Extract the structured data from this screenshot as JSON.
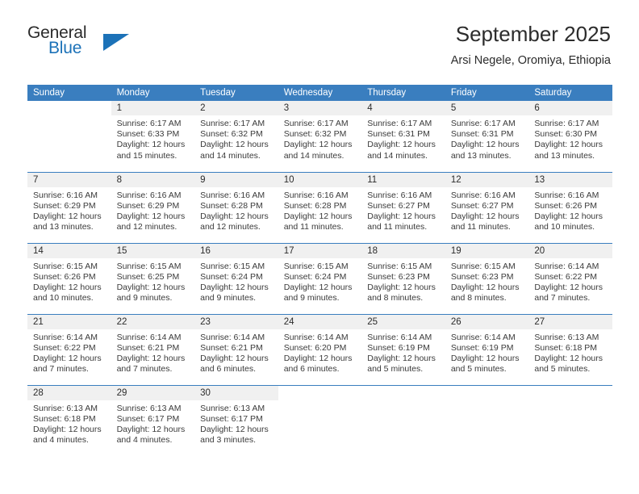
{
  "brand": {
    "name_part1": "General",
    "name_part2": "Blue",
    "logo_icon": "blue-triangle-flag",
    "color_dark": "#2b2b2b",
    "color_blue": "#1c72b8"
  },
  "header": {
    "title": "September 2025",
    "subtitle": "Arsi Negele, Oromiya, Ethiopia"
  },
  "calendar": {
    "header_bg": "#3a7ebf",
    "daynum_bg": "#f0f0f0",
    "weekday_headers": [
      "Sunday",
      "Monday",
      "Tuesday",
      "Wednesday",
      "Thursday",
      "Friday",
      "Saturday"
    ],
    "weeks": [
      [
        {
          "day": "",
          "sunrise": "",
          "sunset": "",
          "daylight_line1": "",
          "daylight_line2": "",
          "blank": true
        },
        {
          "day": "1",
          "sunrise": "Sunrise: 6:17 AM",
          "sunset": "Sunset: 6:33 PM",
          "daylight_line1": "Daylight: 12 hours",
          "daylight_line2": "and 15 minutes."
        },
        {
          "day": "2",
          "sunrise": "Sunrise: 6:17 AM",
          "sunset": "Sunset: 6:32 PM",
          "daylight_line1": "Daylight: 12 hours",
          "daylight_line2": "and 14 minutes."
        },
        {
          "day": "3",
          "sunrise": "Sunrise: 6:17 AM",
          "sunset": "Sunset: 6:32 PM",
          "daylight_line1": "Daylight: 12 hours",
          "daylight_line2": "and 14 minutes."
        },
        {
          "day": "4",
          "sunrise": "Sunrise: 6:17 AM",
          "sunset": "Sunset: 6:31 PM",
          "daylight_line1": "Daylight: 12 hours",
          "daylight_line2": "and 14 minutes."
        },
        {
          "day": "5",
          "sunrise": "Sunrise: 6:17 AM",
          "sunset": "Sunset: 6:31 PM",
          "daylight_line1": "Daylight: 12 hours",
          "daylight_line2": "and 13 minutes."
        },
        {
          "day": "6",
          "sunrise": "Sunrise: 6:17 AM",
          "sunset": "Sunset: 6:30 PM",
          "daylight_line1": "Daylight: 12 hours",
          "daylight_line2": "and 13 minutes."
        }
      ],
      [
        {
          "day": "7",
          "sunrise": "Sunrise: 6:16 AM",
          "sunset": "Sunset: 6:29 PM",
          "daylight_line1": "Daylight: 12 hours",
          "daylight_line2": "and 13 minutes."
        },
        {
          "day": "8",
          "sunrise": "Sunrise: 6:16 AM",
          "sunset": "Sunset: 6:29 PM",
          "daylight_line1": "Daylight: 12 hours",
          "daylight_line2": "and 12 minutes."
        },
        {
          "day": "9",
          "sunrise": "Sunrise: 6:16 AM",
          "sunset": "Sunset: 6:28 PM",
          "daylight_line1": "Daylight: 12 hours",
          "daylight_line2": "and 12 minutes."
        },
        {
          "day": "10",
          "sunrise": "Sunrise: 6:16 AM",
          "sunset": "Sunset: 6:28 PM",
          "daylight_line1": "Daylight: 12 hours",
          "daylight_line2": "and 11 minutes."
        },
        {
          "day": "11",
          "sunrise": "Sunrise: 6:16 AM",
          "sunset": "Sunset: 6:27 PM",
          "daylight_line1": "Daylight: 12 hours",
          "daylight_line2": "and 11 minutes."
        },
        {
          "day": "12",
          "sunrise": "Sunrise: 6:16 AM",
          "sunset": "Sunset: 6:27 PM",
          "daylight_line1": "Daylight: 12 hours",
          "daylight_line2": "and 11 minutes."
        },
        {
          "day": "13",
          "sunrise": "Sunrise: 6:16 AM",
          "sunset": "Sunset: 6:26 PM",
          "daylight_line1": "Daylight: 12 hours",
          "daylight_line2": "and 10 minutes."
        }
      ],
      [
        {
          "day": "14",
          "sunrise": "Sunrise: 6:15 AM",
          "sunset": "Sunset: 6:26 PM",
          "daylight_line1": "Daylight: 12 hours",
          "daylight_line2": "and 10 minutes."
        },
        {
          "day": "15",
          "sunrise": "Sunrise: 6:15 AM",
          "sunset": "Sunset: 6:25 PM",
          "daylight_line1": "Daylight: 12 hours",
          "daylight_line2": "and 9 minutes."
        },
        {
          "day": "16",
          "sunrise": "Sunrise: 6:15 AM",
          "sunset": "Sunset: 6:24 PM",
          "daylight_line1": "Daylight: 12 hours",
          "daylight_line2": "and 9 minutes."
        },
        {
          "day": "17",
          "sunrise": "Sunrise: 6:15 AM",
          "sunset": "Sunset: 6:24 PM",
          "daylight_line1": "Daylight: 12 hours",
          "daylight_line2": "and 9 minutes."
        },
        {
          "day": "18",
          "sunrise": "Sunrise: 6:15 AM",
          "sunset": "Sunset: 6:23 PM",
          "daylight_line1": "Daylight: 12 hours",
          "daylight_line2": "and 8 minutes."
        },
        {
          "day": "19",
          "sunrise": "Sunrise: 6:15 AM",
          "sunset": "Sunset: 6:23 PM",
          "daylight_line1": "Daylight: 12 hours",
          "daylight_line2": "and 8 minutes."
        },
        {
          "day": "20",
          "sunrise": "Sunrise: 6:14 AM",
          "sunset": "Sunset: 6:22 PM",
          "daylight_line1": "Daylight: 12 hours",
          "daylight_line2": "and 7 minutes."
        }
      ],
      [
        {
          "day": "21",
          "sunrise": "Sunrise: 6:14 AM",
          "sunset": "Sunset: 6:22 PM",
          "daylight_line1": "Daylight: 12 hours",
          "daylight_line2": "and 7 minutes."
        },
        {
          "day": "22",
          "sunrise": "Sunrise: 6:14 AM",
          "sunset": "Sunset: 6:21 PM",
          "daylight_line1": "Daylight: 12 hours",
          "daylight_line2": "and 7 minutes."
        },
        {
          "day": "23",
          "sunrise": "Sunrise: 6:14 AM",
          "sunset": "Sunset: 6:21 PM",
          "daylight_line1": "Daylight: 12 hours",
          "daylight_line2": "and 6 minutes."
        },
        {
          "day": "24",
          "sunrise": "Sunrise: 6:14 AM",
          "sunset": "Sunset: 6:20 PM",
          "daylight_line1": "Daylight: 12 hours",
          "daylight_line2": "and 6 minutes."
        },
        {
          "day": "25",
          "sunrise": "Sunrise: 6:14 AM",
          "sunset": "Sunset: 6:19 PM",
          "daylight_line1": "Daylight: 12 hours",
          "daylight_line2": "and 5 minutes."
        },
        {
          "day": "26",
          "sunrise": "Sunrise: 6:14 AM",
          "sunset": "Sunset: 6:19 PM",
          "daylight_line1": "Daylight: 12 hours",
          "daylight_line2": "and 5 minutes."
        },
        {
          "day": "27",
          "sunrise": "Sunrise: 6:13 AM",
          "sunset": "Sunset: 6:18 PM",
          "daylight_line1": "Daylight: 12 hours",
          "daylight_line2": "and 5 minutes."
        }
      ],
      [
        {
          "day": "28",
          "sunrise": "Sunrise: 6:13 AM",
          "sunset": "Sunset: 6:18 PM",
          "daylight_line1": "Daylight: 12 hours",
          "daylight_line2": "and 4 minutes."
        },
        {
          "day": "29",
          "sunrise": "Sunrise: 6:13 AM",
          "sunset": "Sunset: 6:17 PM",
          "daylight_line1": "Daylight: 12 hours",
          "daylight_line2": "and 4 minutes."
        },
        {
          "day": "30",
          "sunrise": "Sunrise: 6:13 AM",
          "sunset": "Sunset: 6:17 PM",
          "daylight_line1": "Daylight: 12 hours",
          "daylight_line2": "and 3 minutes."
        },
        {
          "day": "",
          "sunrise": "",
          "sunset": "",
          "daylight_line1": "",
          "daylight_line2": "",
          "blank": true
        },
        {
          "day": "",
          "sunrise": "",
          "sunset": "",
          "daylight_line1": "",
          "daylight_line2": "",
          "blank": true
        },
        {
          "day": "",
          "sunrise": "",
          "sunset": "",
          "daylight_line1": "",
          "daylight_line2": "",
          "blank": true
        },
        {
          "day": "",
          "sunrise": "",
          "sunset": "",
          "daylight_line1": "",
          "daylight_line2": "",
          "blank": true
        }
      ]
    ]
  }
}
